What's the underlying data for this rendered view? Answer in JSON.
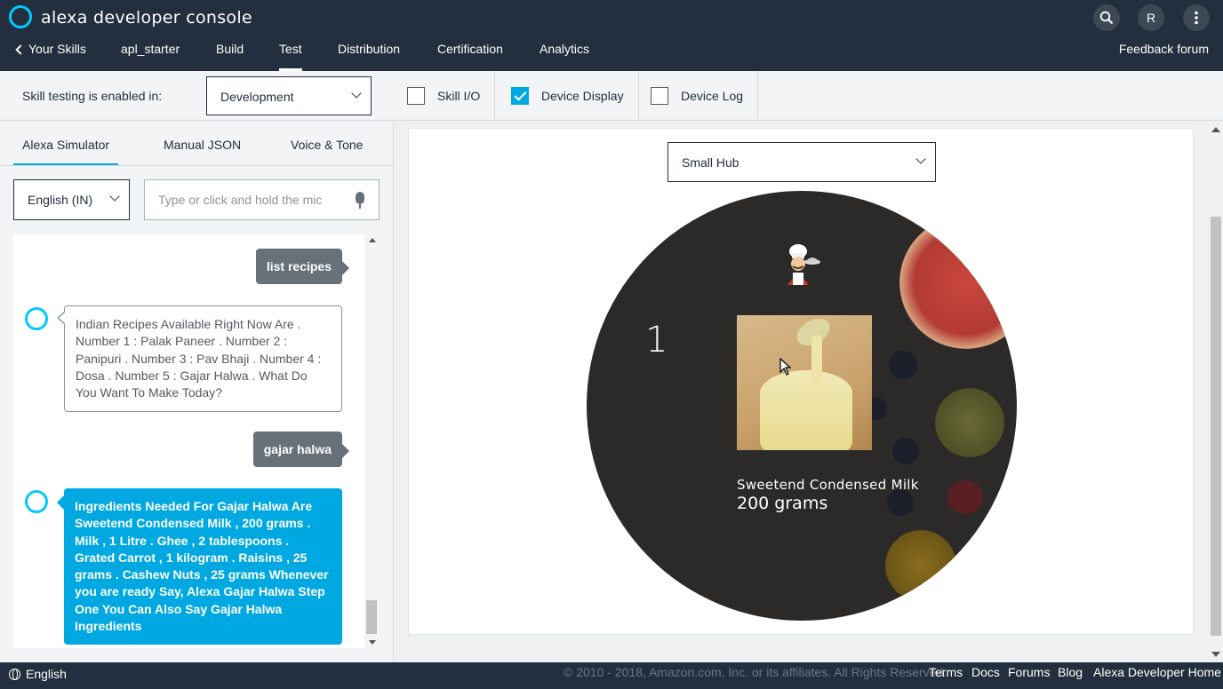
{
  "header": {
    "brand": "alexa developer console",
    "avatar_initial": "R",
    "back_link": "Your Skills",
    "skill_name": "apl_starter",
    "tabs": [
      "Build",
      "Test",
      "Distribution",
      "Certification",
      "Analytics"
    ],
    "active_tab": "Test",
    "feedback": "Feedback forum"
  },
  "toolbar": {
    "testing_label": "Skill testing is enabled in:",
    "environment": "Development",
    "checks": [
      {
        "label": "Skill I/O",
        "checked": false
      },
      {
        "label": "Device Display",
        "checked": true
      },
      {
        "label": "Device Log",
        "checked": false
      }
    ]
  },
  "simulator": {
    "tabs": [
      "Alexa Simulator",
      "Manual JSON",
      "Voice & Tone"
    ],
    "active_tab": "Alexa Simulator",
    "language": "English (IN)",
    "input_placeholder": "Type or click and hold the mic",
    "conversation": {
      "user_1": "list recipes",
      "alexa_1": "Indian Recipes Available Right Now Are . Number 1 : Palak Paneer . Number 2 : Panipuri . Number 3 : Pav Bhaji . Number 4 : Dosa . Number 5 : Gajar Halwa . What Do You Want To Make Today?",
      "user_2": "gajar halwa",
      "alexa_2": "Ingredients Needed For Gajar Halwa Are Sweetend Condensed Milk , 200 grams . Milk , 1 Litre . Ghee , 2 tablespoons . Grated Carrot , 1 kilogram . Raisins , 25 grams . Cashew Nuts , 25 grams Whenever you are ready Say, Alexa Gajar Halwa Step One You Can Also Say Gajar Halwa Ingredients"
    }
  },
  "device": {
    "selected": "Small Hub",
    "display": {
      "number": "1",
      "ingredient": "Sweetend Condensed Milk",
      "quantity": "200 grams"
    }
  },
  "footer": {
    "language": "English",
    "copyright": "© 2010 - 2018, Amazon.com, Inc. or its affiliates. All Rights Reserved.",
    "links": [
      "Terms",
      "Docs",
      "Forums",
      "Blog",
      "Alexa Developer Home"
    ]
  },
  "colors": {
    "header_bg": "#232f3e",
    "accent": "#00a8e1",
    "alexa_ring": "#00caff"
  }
}
